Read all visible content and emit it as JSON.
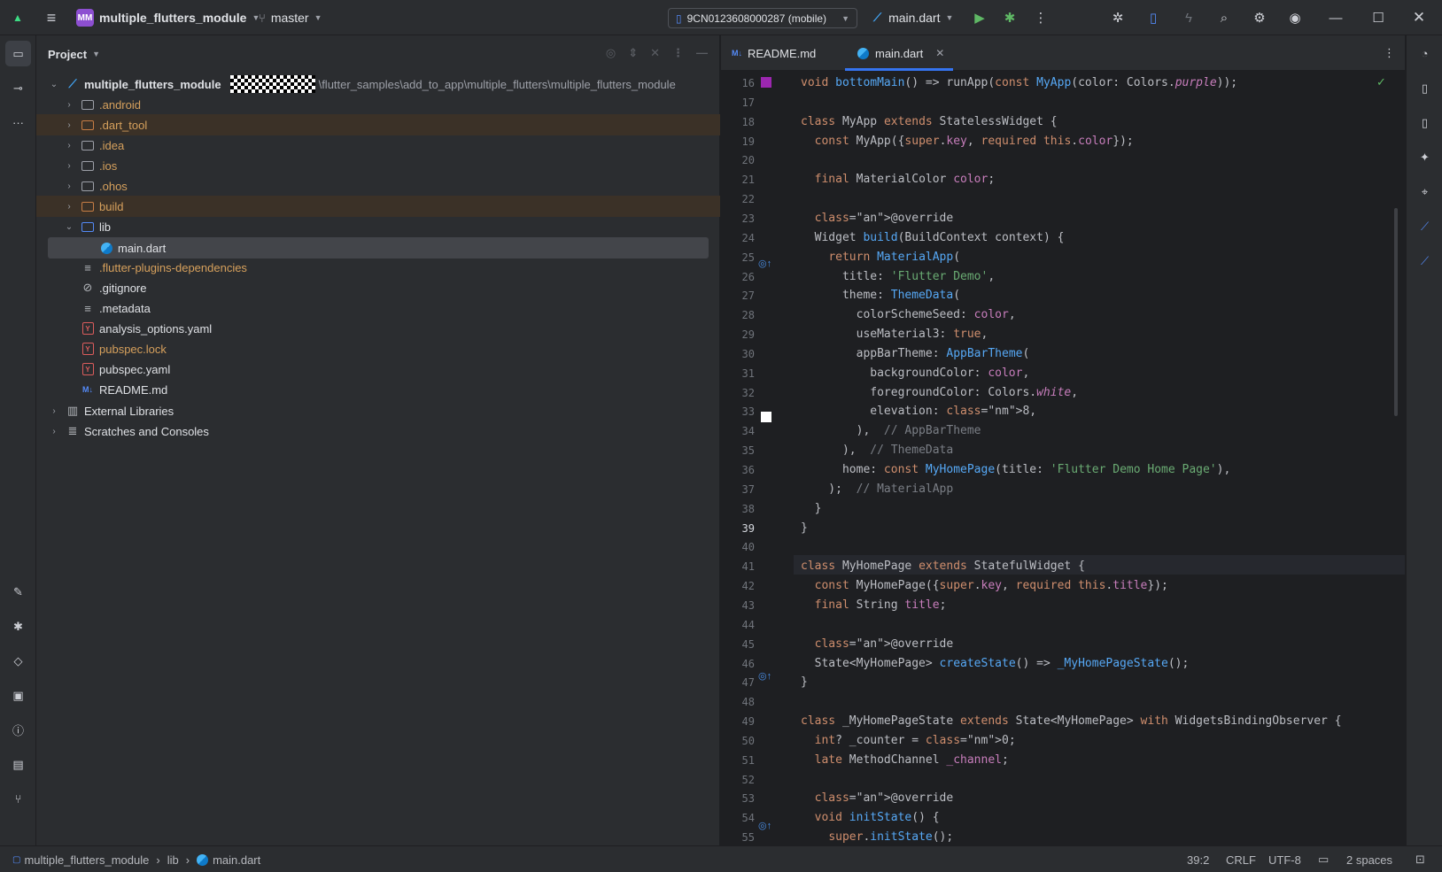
{
  "titlebar": {
    "project_initials": "MM",
    "project_name": "multiple_flutters_module",
    "branch": "master",
    "device": "9CN0123608000287 (mobile)",
    "run_config": "main.dart"
  },
  "project_panel": {
    "title": "Project",
    "root": {
      "name": "multiple_flutters_module",
      "path": "\\flutter_samples\\add_to_app\\multiple_flutters\\multiple_flutters_module"
    },
    "items": [
      {
        "label": ".android"
      },
      {
        "label": ".dart_tool"
      },
      {
        "label": ".idea"
      },
      {
        "label": ".ios"
      },
      {
        "label": ".ohos"
      },
      {
        "label": "build"
      },
      {
        "label": "lib"
      },
      {
        "label": "main.dart"
      },
      {
        "label": ".flutter-plugins-dependencies"
      },
      {
        "label": ".gitignore"
      },
      {
        "label": ".metadata"
      },
      {
        "label": "analysis_options.yaml"
      },
      {
        "label": "pubspec.lock"
      },
      {
        "label": "pubspec.yaml"
      },
      {
        "label": "README.md"
      },
      {
        "label": "External Libraries"
      },
      {
        "label": "Scratches and Consoles"
      }
    ]
  },
  "editor": {
    "tabs": [
      {
        "label": "README.md"
      },
      {
        "label": "main.dart"
      }
    ],
    "line_numbers": [
      "16",
      "17",
      "18",
      "19",
      "20",
      "21",
      "22",
      "23",
      "24",
      "25",
      "26",
      "27",
      "28",
      "29",
      "30",
      "31",
      "32",
      "33",
      "34",
      "35",
      "36",
      "37",
      "38",
      "39",
      "40",
      "41",
      "42",
      "43",
      "44",
      "45",
      "46",
      "47",
      "48",
      "49",
      "50",
      "51",
      "52",
      "53",
      "54",
      "55"
    ],
    "code_lines": [
      "void bottomMain() => runApp(const MyApp(color: Colors.purple));",
      "",
      "class MyApp extends StatelessWidget {",
      "  const MyApp({super.key, required this.color});",
      "",
      "  final MaterialColor color;",
      "",
      "  @override",
      "  Widget build(BuildContext context) {",
      "    return MaterialApp(",
      "      title: 'Flutter Demo',",
      "      theme: ThemeData(",
      "        colorSchemeSeed: color,",
      "        useMaterial3: true,",
      "        appBarTheme: AppBarTheme(",
      "          backgroundColor: color,",
      "          foregroundColor: Colors.white,",
      "          elevation: 8,",
      "        ),  // AppBarTheme",
      "      ),  // ThemeData",
      "      home: const MyHomePage(title: 'Flutter Demo Home Page'),",
      "    );  // MaterialApp",
      "  }",
      "}",
      "",
      "class MyHomePage extends StatefulWidget {",
      "  const MyHomePage({super.key, required this.title});",
      "  final String title;",
      "",
      "  @override",
      "  State<MyHomePage> createState() => _MyHomePageState();",
      "}",
      "",
      "class _MyHomePageState extends State<MyHomePage> with WidgetsBindingObserver {",
      "  int? _counter = 0;",
      "  late MethodChannel _channel;",
      "",
      "  @override",
      "  void initState() {",
      "    super.initState();"
    ]
  },
  "statusbar": {
    "breadcrumb": [
      "multiple_flutters_module",
      "lib",
      "main.dart"
    ],
    "position": "39:2",
    "line_ending": "CRLF",
    "encoding": "UTF-8",
    "indent": "2 spaces"
  },
  "colors": {
    "accent": "#3574f0",
    "gutter_purple": "#9c27b0",
    "gutter_white": "#ffffff"
  }
}
